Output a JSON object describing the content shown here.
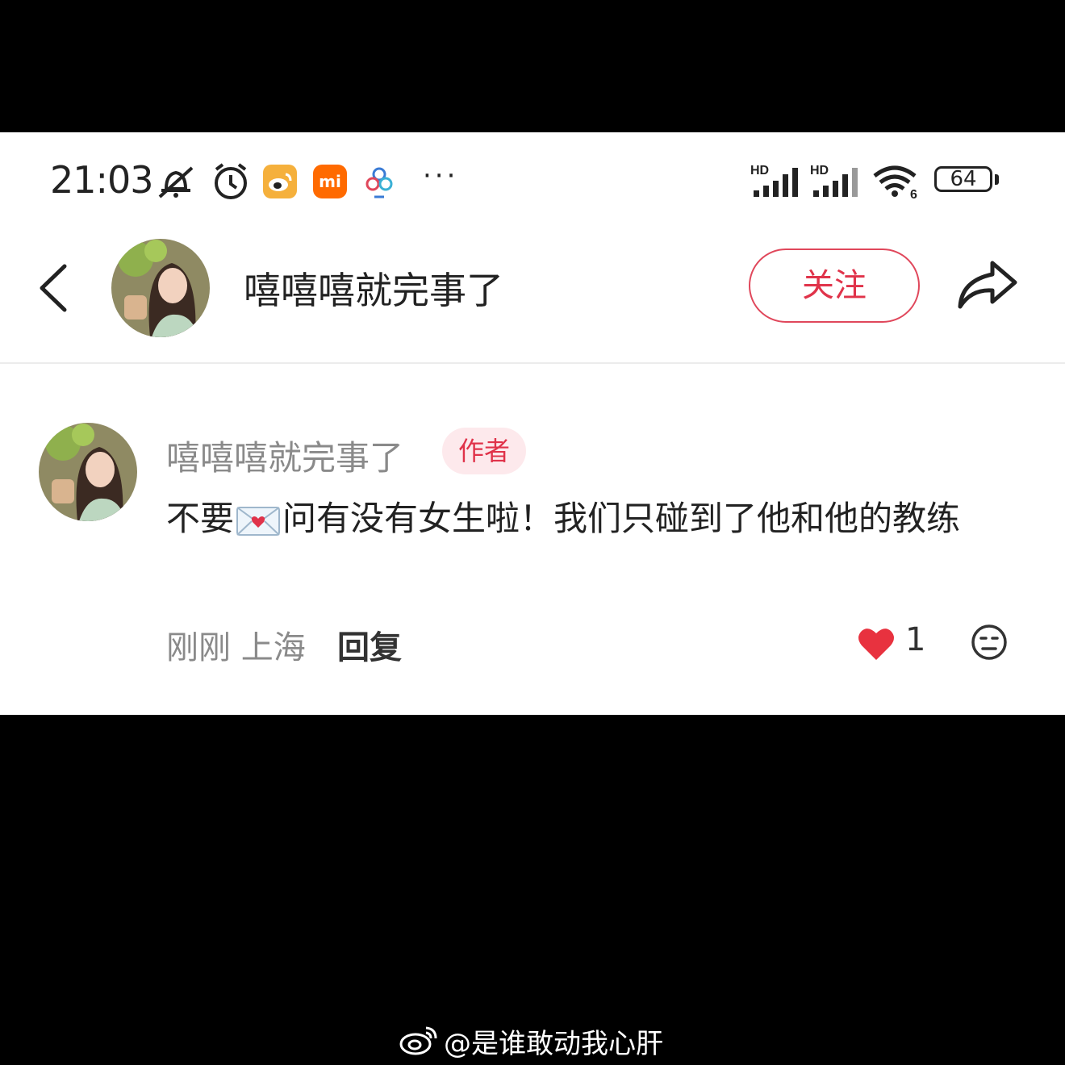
{
  "status_bar": {
    "time": "21:03",
    "mi_label": "mi",
    "more": "···",
    "signal_1_label": "HD",
    "signal_2_label": "HD",
    "wifi_label": "6",
    "battery": "64"
  },
  "header": {
    "title": "嘻嘻嘻就完事了",
    "follow_label": "关注"
  },
  "comment": {
    "author": "嘻嘻嘻就完事了",
    "badge": "作者",
    "text_part1": "不要",
    "text_part2": "问有没有女生啦！我们只碰到了他和他的教练",
    "time_location": "刚刚 上海",
    "reply_label": "回复",
    "like_count": "1"
  },
  "watermark": {
    "text": "@是谁敢动我心肝"
  },
  "colors": {
    "accent": "#e0334a",
    "heart": "#e8323f",
    "gray_text": "#8a8a8a"
  }
}
